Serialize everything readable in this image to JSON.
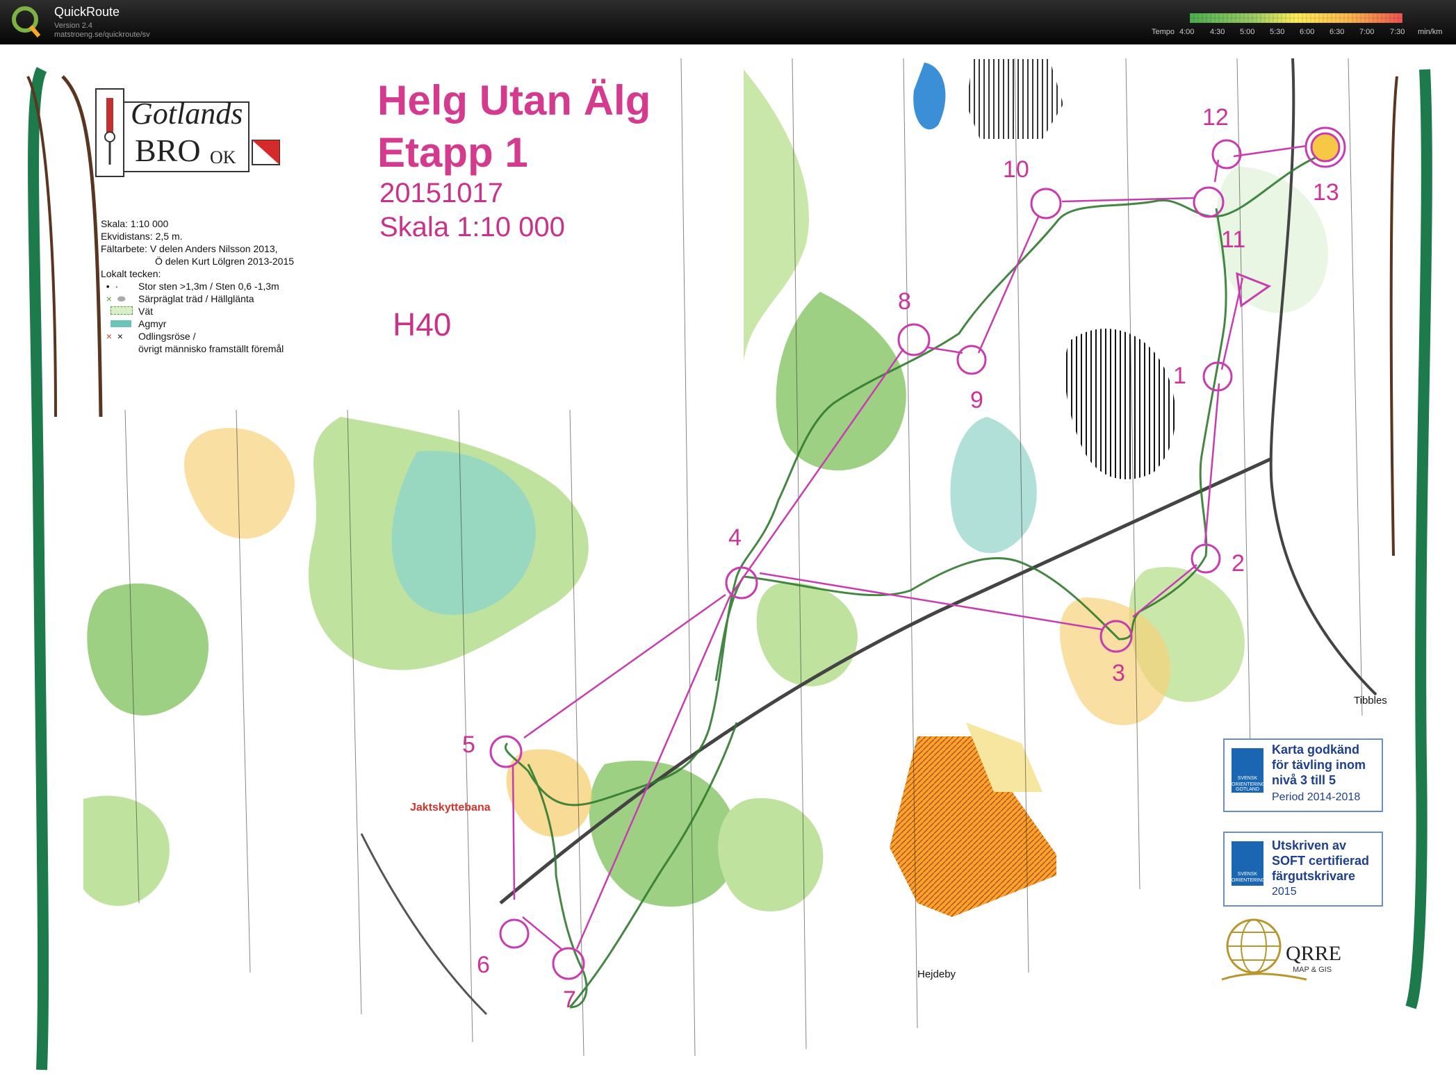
{
  "app": {
    "name": "QuickRoute",
    "version": "Version 2.4",
    "url": "matstroeng.se/quickroute/sv"
  },
  "tempo": {
    "label": "Tempo",
    "ticks": [
      "4:00",
      "4:30",
      "5:00",
      "5:30",
      "6:00",
      "6:30",
      "7:00",
      "7:30"
    ],
    "unit": "min/km",
    "colors": [
      "#4caf50",
      "#9ccc65",
      "#ffee58",
      "#ffb74d",
      "#ef5350"
    ]
  },
  "map": {
    "title": "Helg Utan Älg",
    "stage": "Etapp 1",
    "date": "20151017",
    "scale": "Skala 1:10 000",
    "class": "H40",
    "club_line1": "Gotlands",
    "club_line2": "BRO",
    "club_line3": "OK",
    "legend": [
      "Skala: 1:10 000",
      "Ekvidistans: 2,5 m.",
      "Fältarbete: V delen Anders Nilsson 2013,",
      "Ö delen Kurt Lölgren 2013-2015",
      "Lokalt tecken:",
      "Stor sten >1,3m / Sten 0,6 -1,3m",
      "Särpräglat träd / Hällglänta",
      "Vät",
      "Agmyr",
      "Odlingsröse /",
      "övrigt människo framställt föremål"
    ],
    "controls": [
      "1",
      "2",
      "3",
      "4",
      "5",
      "6",
      "7",
      "8",
      "9",
      "10",
      "11",
      "12",
      "13"
    ],
    "places": {
      "jakt": "Jaktskyttebana",
      "tibbles": "Tibbles",
      "hejdeby": "Hejdeby"
    },
    "badge1": {
      "lines": [
        "Karta godkänd",
        "för tävling inom",
        "nivå 3 till 5"
      ],
      "period": "Period 2014-2018",
      "logo": [
        "SVENSK",
        "ORIENTERING",
        "GOTLAND"
      ]
    },
    "badge2": {
      "lines": [
        "Utskriven av",
        "SOFT certifierad",
        "färgutskrivare"
      ],
      "year": "2015",
      "logo": [
        "SVENSK",
        "ORIENTERING"
      ]
    },
    "qrre": "QRRE",
    "qrre_sub": "MAP & GIS"
  }
}
